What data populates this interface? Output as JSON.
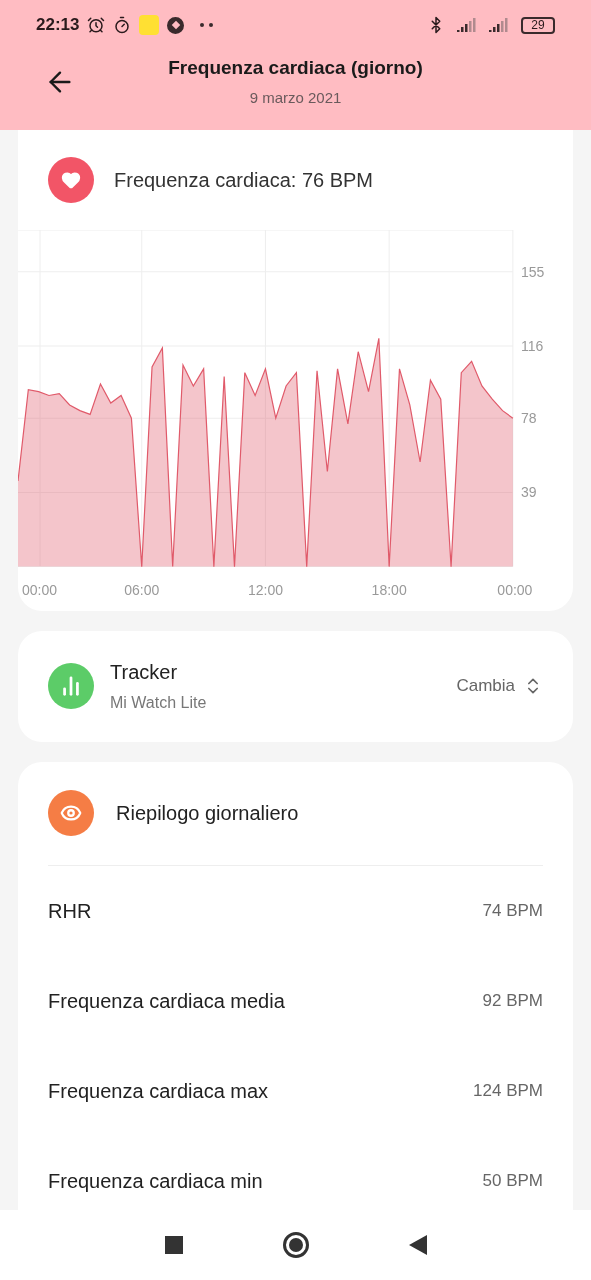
{
  "status_bar": {
    "time": "22:13",
    "battery": "29"
  },
  "header": {
    "title": "Frequenza cardiaca (giorno)",
    "subtitle": "9 marzo 2021"
  },
  "heart_rate_card": {
    "title": "Frequenza cardiaca: 76 BPM",
    "chart_data": {
      "type": "area",
      "x": [
        0,
        0.5,
        1,
        1.5,
        2,
        2.5,
        3,
        3.5,
        4,
        4.5,
        5,
        5.5,
        6,
        6.5,
        7,
        7.5,
        8,
        8.5,
        9,
        9.5,
        10,
        10.5,
        11,
        11.5,
        12,
        12.5,
        13,
        13.5,
        14,
        14.5,
        15,
        15.5,
        16,
        16.5,
        17,
        17.5,
        18,
        18.5,
        19,
        19.5,
        20,
        20.5,
        21,
        21.5,
        22,
        22.5,
        23,
        23.5,
        24
      ],
      "series": [
        {
          "color": "#e05a6a",
          "values": [
            45,
            93,
            92,
            90,
            91,
            85,
            82,
            80,
            96,
            86,
            90,
            78,
            0,
            105,
            115,
            0,
            106,
            95,
            104,
            0,
            100,
            0,
            102,
            90,
            104,
            78,
            95,
            102,
            0,
            103,
            50,
            104,
            75,
            113,
            92,
            120,
            0,
            104,
            85,
            55,
            98,
            88,
            0,
            102,
            108,
            95,
            88,
            82,
            78
          ]
        }
      ],
      "xlim": [
        0,
        24
      ],
      "ylim": [
        0,
        177
      ],
      "xticks": [
        {
          "value": 0,
          "label": "00:00"
        },
        {
          "value": 6,
          "label": "06:00"
        },
        {
          "value": 12,
          "label": "12:00"
        },
        {
          "value": 18,
          "label": "18:00"
        },
        {
          "value": 24,
          "label": "00:00"
        }
      ],
      "yticks": [
        39,
        78,
        116,
        155
      ],
      "grid": true
    }
  },
  "tracker_card": {
    "title": "Tracker",
    "device": "Mi Watch Lite",
    "action": "Cambia"
  },
  "summary": {
    "title": "Riepilogo giornaliero",
    "rows": [
      {
        "label": "RHR",
        "value": "74 BPM"
      },
      {
        "label": "Frequenza cardiaca media",
        "value": "92 BPM"
      },
      {
        "label": "Frequenza cardiaca max",
        "value": "124 BPM"
      },
      {
        "label": "Frequenza cardiaca min",
        "value": "50 BPM"
      }
    ]
  }
}
